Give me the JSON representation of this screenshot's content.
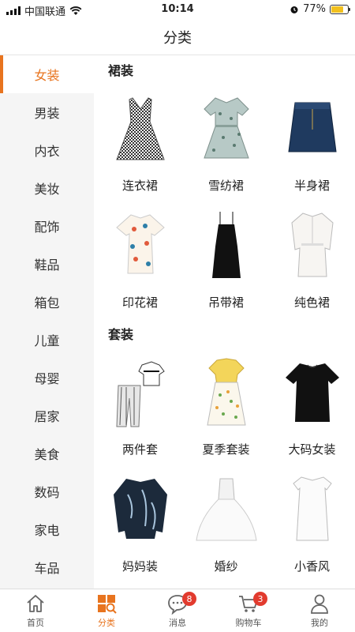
{
  "status_bar": {
    "carrier": "中国联通",
    "time": "10:14",
    "battery_text": "77%",
    "battery_level": 0.77
  },
  "header": {
    "title": "分类"
  },
  "sidebar": {
    "items": [
      {
        "label": "女装",
        "active": true
      },
      {
        "label": "男装"
      },
      {
        "label": "内衣"
      },
      {
        "label": "美妆"
      },
      {
        "label": "配饰"
      },
      {
        "label": "鞋品"
      },
      {
        "label": "箱包"
      },
      {
        "label": "儿童"
      },
      {
        "label": "母婴"
      },
      {
        "label": "居家"
      },
      {
        "label": "美食"
      },
      {
        "label": "数码"
      },
      {
        "label": "家电"
      },
      {
        "label": "车品"
      }
    ]
  },
  "sections": [
    {
      "title": "裙装",
      "items": [
        {
          "label": "连衣裙",
          "icon": "gingham-dress"
        },
        {
          "label": "雪纺裙",
          "icon": "chiffon-dress"
        },
        {
          "label": "半身裙",
          "icon": "denim-skirt"
        },
        {
          "label": "印花裙",
          "icon": "print-dress"
        },
        {
          "label": "吊带裙",
          "icon": "slip-dress"
        },
        {
          "label": "纯色裙",
          "icon": "shirt-dress"
        }
      ]
    },
    {
      "title": "套装",
      "items": [
        {
          "label": "两件套",
          "icon": "two-piece-set"
        },
        {
          "label": "夏季套装",
          "icon": "summer-set"
        },
        {
          "label": "大码女装",
          "icon": "plus-size-tee"
        },
        {
          "label": "妈妈装",
          "icon": "mom-blouse"
        },
        {
          "label": "婚纱",
          "icon": "wedding-dress"
        },
        {
          "label": "小香风",
          "icon": "white-dress"
        }
      ]
    }
  ],
  "tabbar": {
    "tabs": [
      {
        "label": "首页",
        "icon": "home-icon"
      },
      {
        "label": "分类",
        "icon": "category-icon",
        "active": true
      },
      {
        "label": "消息",
        "icon": "message-icon",
        "badge": "8"
      },
      {
        "label": "购物车",
        "icon": "cart-icon",
        "badge": "3"
      },
      {
        "label": "我的",
        "icon": "profile-icon"
      }
    ]
  },
  "colors": {
    "accent": "#e8741f",
    "badge": "#e23b2e",
    "sidebar_bg": "#f5f5f5"
  }
}
